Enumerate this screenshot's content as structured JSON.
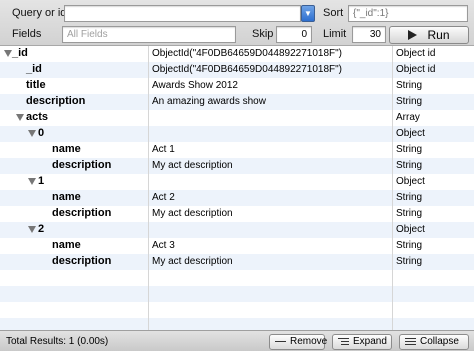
{
  "query": {
    "query_label": "Query or id",
    "query_value": "",
    "sort_label": "Sort",
    "sort_value": "{\"_id\":1}",
    "fields_label": "Fields",
    "fields_placeholder": "All Fields",
    "skip_label": "Skip",
    "skip_value": "0",
    "limit_label": "Limit",
    "limit_value": "30",
    "run_label": "Run"
  },
  "rows": [
    {
      "key": "_id",
      "value": "ObjectId(\"4F0DB64659D044892271018F\")",
      "type": "Object id",
      "expanded": true
    },
    {
      "key": "_id",
      "value": "ObjectId(\"4F0DB64659D044892271018F\")",
      "type": "Object id"
    },
    {
      "key": "title",
      "value": "Awards Show 2012",
      "type": "String"
    },
    {
      "key": "description",
      "value": "An amazing awards show",
      "type": "String"
    },
    {
      "key": "acts",
      "value": "",
      "type": "Array",
      "expanded": true
    },
    {
      "key": "0",
      "value": "",
      "type": "Object",
      "expanded": true
    },
    {
      "key": "name",
      "value": "Act 1",
      "type": "String"
    },
    {
      "key": "description",
      "value": "My act description",
      "type": "String"
    },
    {
      "key": "1",
      "value": "",
      "type": "Object",
      "expanded": true
    },
    {
      "key": "name",
      "value": "Act 2",
      "type": "String"
    },
    {
      "key": "description",
      "value": "My act description",
      "type": "String"
    },
    {
      "key": "2",
      "value": "",
      "type": "Object",
      "expanded": true
    },
    {
      "key": "name",
      "value": "Act 3",
      "type": "String"
    },
    {
      "key": "description",
      "value": "My act description",
      "type": "String"
    }
  ],
  "footer": {
    "status": "Total Results: 1 (0.00s)",
    "remove_label": "Remove",
    "expand_label": "Expand",
    "collapse_label": "Collapse"
  }
}
